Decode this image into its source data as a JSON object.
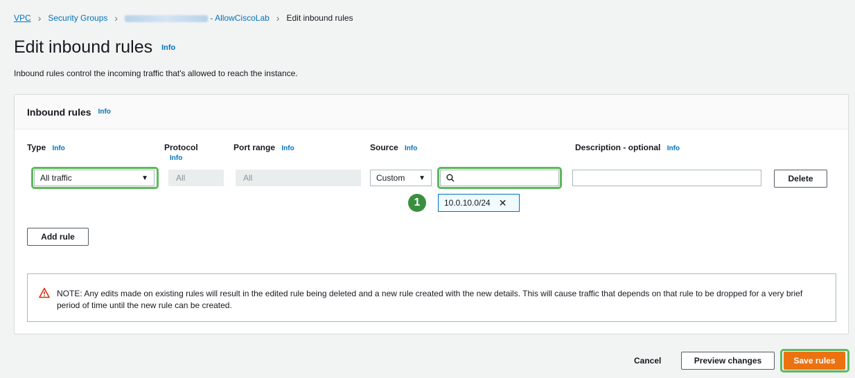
{
  "breadcrumb": {
    "vpc": "VPC",
    "security_groups": "Security Groups",
    "sg_suffix": "- AllowCiscoLab",
    "current": "Edit inbound rules"
  },
  "header": {
    "title": "Edit inbound rules",
    "info": "Info",
    "description": "Inbound rules control the incoming traffic that's allowed to reach the instance."
  },
  "panel": {
    "title": "Inbound rules",
    "info": "Info",
    "columns": {
      "type": "Type",
      "protocol": "Protocol",
      "port_range": "Port range",
      "source": "Source",
      "description": "Description - optional"
    },
    "info_label": "Info",
    "rule": {
      "type": "All traffic",
      "protocol": "All",
      "port_range": "All",
      "source_mode": "Custom",
      "search_value": "",
      "description": "",
      "token": "10.0.10.0/24"
    },
    "delete_label": "Delete",
    "add_rule_label": "Add rule",
    "badge_number": "1",
    "note": "NOTE: Any edits made on existing rules will result in the edited rule being deleted and a new rule created with the new details. This will cause traffic that depends on that rule to be dropped for a very brief period of time until the new rule can be created."
  },
  "footer": {
    "cancel": "Cancel",
    "preview": "Preview changes",
    "save": "Save rules"
  },
  "colors": {
    "link": "#0073bb",
    "primary": "#ec7211",
    "highlight": "#5cb85c",
    "warning": "#d13212"
  }
}
